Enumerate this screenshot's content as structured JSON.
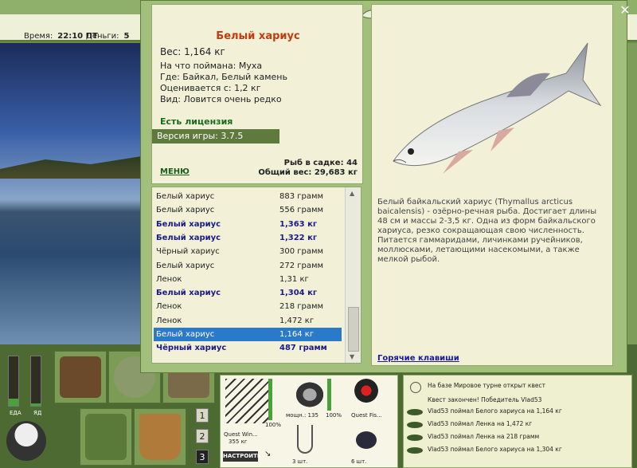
{
  "topbar": {
    "time_label": "Время:",
    "time_value": "22:10 ПТ",
    "money_label": "Деньги:",
    "money_value": "5"
  },
  "fish": {
    "title": "Белый хариус",
    "weight": "Вес: 1,164 кг",
    "caught_on": "На что поймана: Муха",
    "where": "Где: Байкал, Белый камень",
    "value": "Оценивается с: 1,2 кг",
    "kind": "Вид: Ловится очень редко",
    "license": "Есть лицензия",
    "version": "Версия игры: 3.7.5",
    "menu": "МЕНЮ",
    "in_cage": "Рыб в садке: 44",
    "total_weight": "Общий вес: 29,683 кг",
    "description": "Белый байкальский хариус (Thymallus arcticus baicalensis) - озёрно-речная рыба. Достигает длины 48 см и массы 2-3,5 кг. Одна из форм байкальского хариуса, резко сокращающая свою численность. Питается гаммаридами, личинками ручейников, моллюсками, летающими насекомыми, а также мелкой рыбой.",
    "hotkeys": "Горячие клавиши"
  },
  "catch_list": [
    {
      "name": "Белый хариус",
      "weight": "883 грамм",
      "big": false
    },
    {
      "name": "Белый хариус",
      "weight": "556 грамм",
      "big": false
    },
    {
      "name": "Белый хариус",
      "weight": "1,363 кг",
      "big": true
    },
    {
      "name": "Белый хариус",
      "weight": "1,322 кг",
      "big": true
    },
    {
      "name": "Чёрный хариус",
      "weight": "300 грамм",
      "big": false
    },
    {
      "name": "Белый хариус",
      "weight": "272 грамм",
      "big": false
    },
    {
      "name": "Ленок",
      "weight": "1,31 кг",
      "big": false
    },
    {
      "name": "Белый хариус",
      "weight": "1,304 кг",
      "big": true
    },
    {
      "name": "Ленок",
      "weight": "218 грамм",
      "big": false
    },
    {
      "name": "Ленок",
      "weight": "1,472 кг",
      "big": false
    },
    {
      "name": "Белый хариус",
      "weight": "1,164 кг",
      "big": false,
      "selected": true
    },
    {
      "name": "Чёрный хариус",
      "weight": "487 грамм",
      "big": true
    }
  ],
  "hud": {
    "food_label": "ЕДА",
    "poison_label": "ЯД",
    "food_level": 0.15,
    "poison_level": 0.05,
    "slot_buttons": [
      "1",
      "2",
      "3"
    ],
    "rod_name": "Quest Win...",
    "rod_weight": "355 кг",
    "setup_btn": "НАСТРОИТЬ",
    "reel_power": "мощн.: 135",
    "reel_pct": "100%",
    "rod_pct": "100%",
    "line_name": "Quest Fis...",
    "hooks": "3 шт.",
    "bait": "6 шт."
  },
  "events": [
    "На базе Мировое турне открыт квест",
    "Квест закончен! Победитель Vlad53",
    "Vlad53 поймал Белого хариуса на 1,164 кг",
    "Vlad53 поймал Ленка на 1,472 кг",
    "Vlad53 поймал Ленка на 218 грамм",
    "Vlad53 поймал Белого хариуса на 1,304 кг"
  ],
  "colors": {
    "accent": "#c23b0e",
    "selection": "#2b7ac9",
    "panel": "#f2f1d8",
    "frame": "#a2bf7c"
  }
}
